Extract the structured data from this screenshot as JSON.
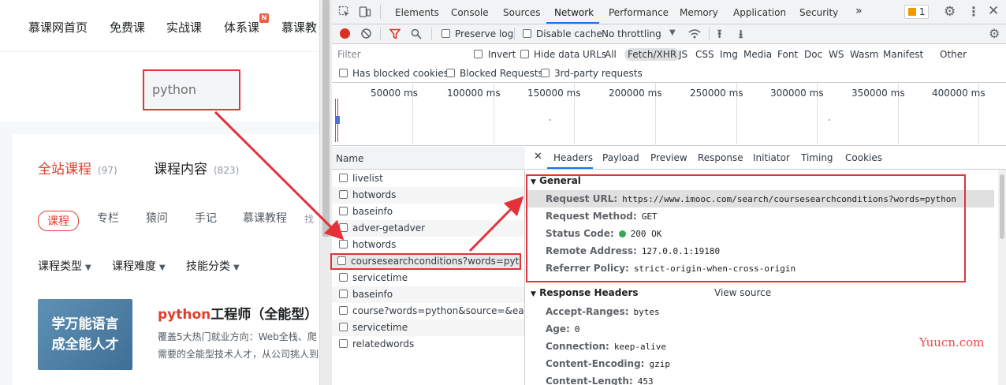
{
  "site": {
    "nav": [
      "慕课网首页",
      "免费课",
      "实战课",
      "体系课",
      "慕课教"
    ],
    "nav_badge": "N",
    "search_value": "python",
    "tabs": [
      {
        "label": "全站课程",
        "count": "(97)"
      },
      {
        "label": "课程内容",
        "count": "(823)"
      }
    ],
    "pills": [
      "课程",
      "专栏",
      "猿问",
      "手记",
      "慕课教程",
      "找"
    ],
    "filters": [
      "课程类型",
      "课程难度",
      "技能分类"
    ],
    "course": {
      "thumb_line1": "学万能语言",
      "thumb_line2": "成全能人才",
      "title_highlight": "python",
      "title_rest": "工程师（全能型）",
      "desc_line1": "覆盖5大热门就业方向：Web全栈、爬",
      "desc_line2": "需要的全能型技术人才，从公司挑人到"
    }
  },
  "devtools": {
    "panel_tabs": [
      "Elements",
      "Console",
      "Sources",
      "Network",
      "Performance",
      "Memory",
      "Application",
      "Security"
    ],
    "active_panel": "Network",
    "more_tabs": "»",
    "issues_count": "1",
    "toolbar": {
      "preserve_log": "Preserve log",
      "disable_cache": "Disable cache",
      "throttling": "No throttling"
    },
    "filter": {
      "placeholder": "Filter",
      "invert": "Invert",
      "hide_data_urls": "Hide data URLs",
      "types": [
        "All",
        "Fetch/XHR",
        "JS",
        "CSS",
        "Img",
        "Media",
        "Font",
        "Doc",
        "WS",
        "Wasm",
        "Manifest",
        "Other"
      ],
      "active_type": "Fetch/XHR",
      "blocked_cookies": "Has blocked cookies",
      "blocked_requests": "Blocked Requests",
      "third_party": "3rd-party requests"
    },
    "timeline_ticks": [
      "50000 ms",
      "100000 ms",
      "150000 ms",
      "200000 ms",
      "250000 ms",
      "300000 ms",
      "350000 ms",
      "400000 ms"
    ],
    "requests_header": "Name",
    "requests": [
      "livelist",
      "hotwords",
      "baseinfo",
      "adver-getadver",
      "hotwords",
      "coursesearchconditions?words=python",
      "servicetime",
      "baseinfo",
      "course?words=python&source=&easy...",
      "servicetime",
      "relatedwords"
    ],
    "selected_request_index": 5,
    "detail_tabs": [
      "Headers",
      "Payload",
      "Preview",
      "Response",
      "Initiator",
      "Timing",
      "Cookies"
    ],
    "active_detail_tab": "Headers",
    "general": {
      "title": "General",
      "rows": [
        {
          "k": "Request URL:",
          "v": "https://www.imooc.com/search/coursesearchconditions?words=python"
        },
        {
          "k": "Request Method:",
          "v": "GET"
        },
        {
          "k": "Status Code:",
          "v": "200 OK"
        },
        {
          "k": "Remote Address:",
          "v": "127.0.0.1:19180"
        },
        {
          "k": "Referrer Policy:",
          "v": "strict-origin-when-cross-origin"
        }
      ]
    },
    "response_headers": {
      "title": "Response Headers",
      "view_source": "View source",
      "rows": [
        {
          "k": "Accept-Ranges:",
          "v": "bytes"
        },
        {
          "k": "Age:",
          "v": "0"
        },
        {
          "k": "Connection:",
          "v": "keep-alive"
        },
        {
          "k": "Content-Encoding:",
          "v": "gzip"
        },
        {
          "k": "Content-Length:",
          "v": "453"
        }
      ]
    }
  },
  "watermark": "Yuucn.com",
  "colors": {
    "highlight_red": "#e5313a",
    "accent_blue": "#1a73e8",
    "record_red": "#d93025",
    "status_green": "#34a853",
    "brand_red": "#e03e2d"
  }
}
